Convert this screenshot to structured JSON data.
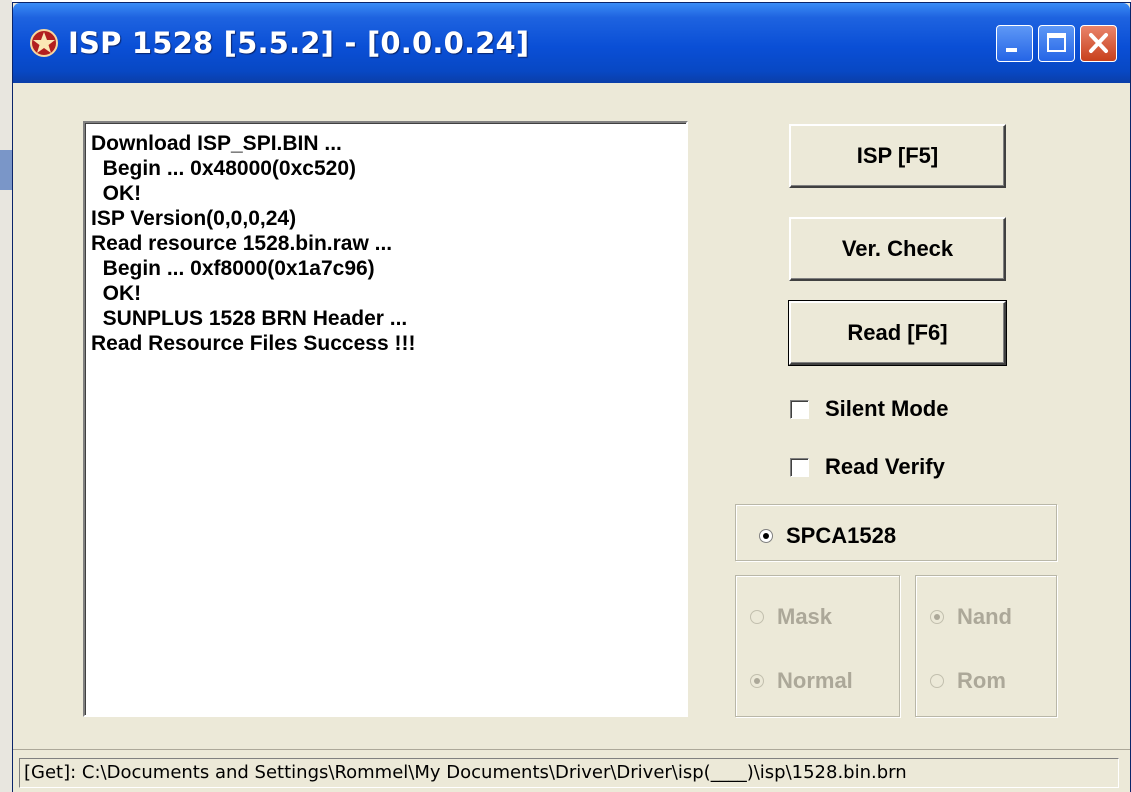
{
  "window": {
    "title": "ISP 1528 [5.5.2] - [0.0.0.24]",
    "controls": [
      "minimize-icon",
      "maximize-icon",
      "close-icon"
    ]
  },
  "log": {
    "lines": [
      "Download ISP_SPI.BIN ...",
      "  Begin ... 0x48000(0xc520)",
      "  OK!",
      "ISP Version(0,0,0,24)",
      "Read resource 1528.bin.raw ...",
      "  Begin ... 0xf8000(0x1a7c96)",
      "  OK!",
      "  SUNPLUS 1528 BRN Header ...",
      "Read Resource Files Success !!!"
    ]
  },
  "buttons": {
    "isp": "ISP [F5]",
    "ver_check": "Ver. Check",
    "read": "Read [F6]"
  },
  "checkboxes": {
    "silent_mode": {
      "label": "Silent Mode",
      "checked": false
    },
    "read_verify": {
      "label": "Read Verify",
      "checked": false
    }
  },
  "chip": {
    "label": "SPCA1528",
    "selected": true
  },
  "mode_group": {
    "mask": {
      "label": "Mask",
      "selected": false,
      "enabled": false
    },
    "normal": {
      "label": "Normal",
      "selected": true,
      "enabled": false
    }
  },
  "storage_group": {
    "nand": {
      "label": "Nand",
      "selected": true,
      "enabled": false
    },
    "rom": {
      "label": "Rom",
      "selected": false,
      "enabled": false
    }
  },
  "status": {
    "text": "[Get]: C:\\Documents and Settings\\Rommel\\My Documents\\Driver\\Driver\\isp(____)\\isp\\1528.bin.brn"
  },
  "colors": {
    "titlebar": "#0a4fd6",
    "face": "#ece9d8",
    "disabled_text": "#aca899",
    "close_button": "#c8401c"
  }
}
